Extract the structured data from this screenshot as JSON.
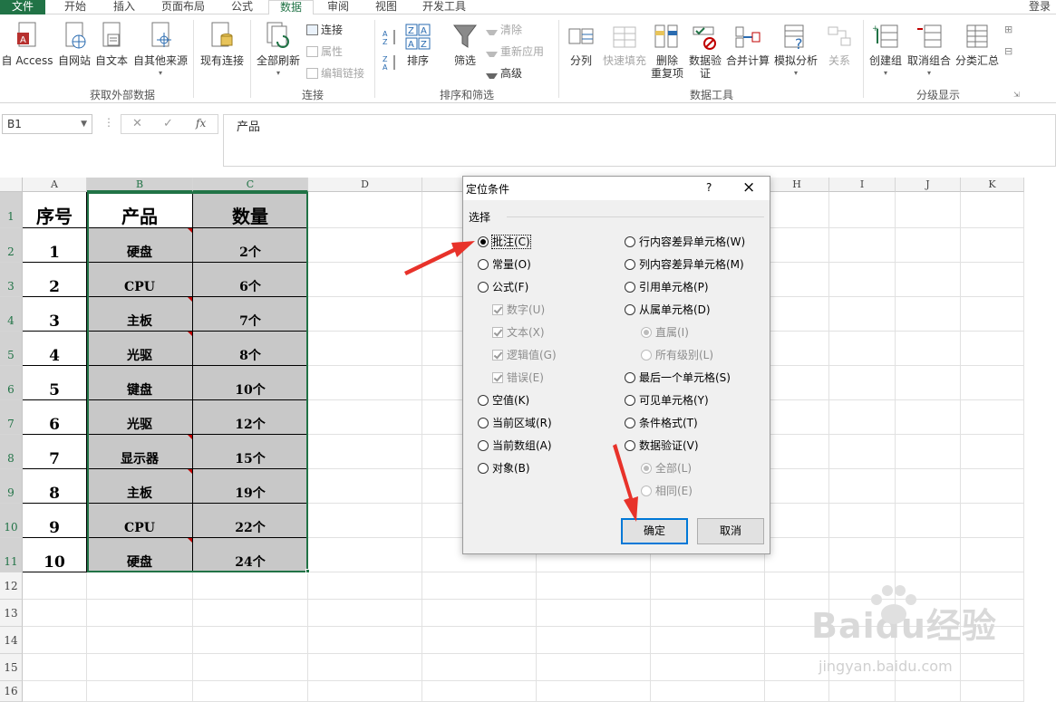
{
  "tabs": {
    "file": "文件",
    "home": "开始",
    "insert": "插入",
    "layout": "页面布局",
    "formulas": "公式",
    "data": "数据",
    "review": "审阅",
    "view": "视图",
    "developer": "开发工具",
    "login": "登录"
  },
  "ribbon": {
    "ext": {
      "from_access": "自 Access",
      "from_web": "自网站",
      "from_text": "自文本",
      "from_other": "自其他来源",
      "existing": "现有连接",
      "group": "获取外部数据"
    },
    "conn": {
      "refresh_all": "全部刷新",
      "connections": "连接",
      "properties": "属性",
      "edit_links": "编辑链接",
      "group": "连接"
    },
    "sort": {
      "sort": "排序",
      "filter": "筛选",
      "clear": "清除",
      "reapply": "重新应用",
      "advanced": "高级",
      "group": "排序和筛选"
    },
    "tools": {
      "split": "分列",
      "flash": "快速填充",
      "remove_dup_1": "删除",
      "remove_dup_2": "重复项",
      "validation_1": "数据验",
      "validation_2": "证",
      "consolidate": "合并计算",
      "whatif": "模拟分析",
      "relations": "关系",
      "group": "数据工具"
    },
    "outline": {
      "group_btn": "创建组",
      "ungroup": "取消组合",
      "subtotal": "分类汇总",
      "group": "分级显示"
    }
  },
  "formula_bar": {
    "name_box": "B1",
    "fx": "fx",
    "content": "产品"
  },
  "columns": [
    "A",
    "B",
    "C",
    "D",
    "E",
    "F",
    "G",
    "H",
    "I",
    "J",
    "K"
  ],
  "rows": [
    "1",
    "2",
    "3",
    "4",
    "5",
    "6",
    "7",
    "8",
    "9",
    "10",
    "11",
    "12",
    "13",
    "14",
    "15",
    "16"
  ],
  "table": {
    "headers": [
      "序号",
      "产品",
      "数量"
    ],
    "rows": [
      {
        "no": "1",
        "product": "硬盘",
        "qty": "2个"
      },
      {
        "no": "2",
        "product": "CPU",
        "qty": "6个"
      },
      {
        "no": "3",
        "product": "主板",
        "qty": "7个"
      },
      {
        "no": "4",
        "product": "光驱",
        "qty": "8个"
      },
      {
        "no": "5",
        "product": "键盘",
        "qty": "10个"
      },
      {
        "no": "6",
        "product": "光驱",
        "qty": "12个"
      },
      {
        "no": "7",
        "product": "显示器",
        "qty": "15个"
      },
      {
        "no": "8",
        "product": "主板",
        "qty": "19个"
      },
      {
        "no": "9",
        "product": "CPU",
        "qty": "22个"
      },
      {
        "no": "10",
        "product": "硬盘",
        "qty": "24个"
      }
    ]
  },
  "dialog": {
    "title": "定位条件",
    "help": "?",
    "close": "×",
    "section": "选择",
    "left": [
      "批注(C)",
      "常量(O)",
      "公式(F)",
      "数字(U)",
      "文本(X)",
      "逻辑值(G)",
      "错误(E)",
      "空值(K)",
      "当前区域(R)",
      "当前数组(A)",
      "对象(B)"
    ],
    "right": [
      "行内容差异单元格(W)",
      "列内容差异单元格(M)",
      "引用单元格(P)",
      "从属单元格(D)",
      "直属(I)",
      "所有级别(L)",
      "最后一个单元格(S)",
      "可见单元格(Y)",
      "条件格式(T)",
      "数据验证(V)",
      "全部(L)",
      "相同(E)"
    ],
    "ok": "确定",
    "cancel": "取消"
  },
  "watermark": {
    "logo": "Baidu经验",
    "url": "jingyan.baidu.com"
  },
  "colors": {
    "accent": "#217346",
    "arrow": "#e8322a",
    "selected_fill": "#c8c8c8"
  }
}
